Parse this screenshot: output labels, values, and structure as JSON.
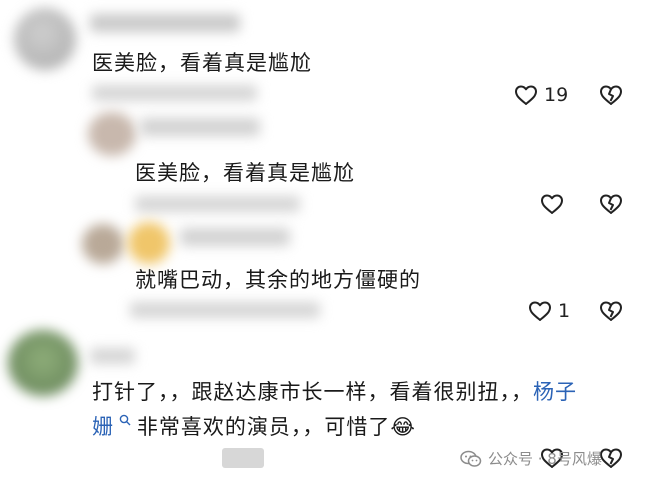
{
  "comments": [
    {
      "id": "c1",
      "text": "医美脸，看着真是尴尬",
      "like_count": "19",
      "like_icon": "heart-outline-icon",
      "dislike_icon": "broken-heart-icon"
    },
    {
      "id": "c2",
      "text": "医美脸，看着真是尴尬",
      "like_count": "",
      "like_icon": "heart-outline-icon",
      "dislike_icon": "broken-heart-icon"
    },
    {
      "id": "c3",
      "text": "就嘴巴动，其余的地方僵硬的",
      "like_count": "1",
      "like_icon": "heart-outline-icon",
      "dislike_icon": "broken-heart-icon"
    },
    {
      "id": "c4",
      "text_line1": "打针了，，跟赵达康市长一样，看着很别扭，，",
      "mention_part1": "杨子",
      "mention_part2": "姗",
      "text_line2_rest": "非常喜欢的演员，，可惜了",
      "emoji": "😂",
      "like_icon": "heart-outline-icon",
      "dislike_icon": "broken-heart-icon"
    }
  ],
  "watermark": {
    "text": "公众号 · 8号风爆",
    "icon": "wechat-icon"
  },
  "colors": {
    "mention": "#2b63b6",
    "text": "#1a1a1a",
    "icon": "#222222",
    "watermark": "#8c8c8c"
  }
}
